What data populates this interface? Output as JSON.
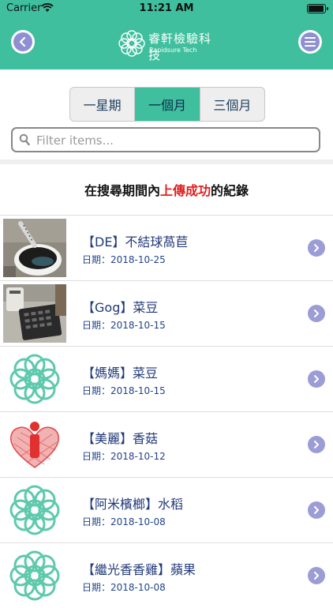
{
  "status_bar": {
    "carrier": "Carrier",
    "time": "11:21 AM"
  },
  "header": {
    "brand_cn": "睿軒檢驗科技",
    "brand_en": "Rapidsure Tech"
  },
  "tabs": [
    {
      "label": "一星期",
      "active": false
    },
    {
      "label": "一個月",
      "active": true
    },
    {
      "label": "三個月",
      "active": false
    }
  ],
  "search": {
    "placeholder": "Filter items...",
    "value": ""
  },
  "headline": {
    "before": "在搜尋期間內",
    "highlight": "上傳成功",
    "after": "的紀錄"
  },
  "records": [
    {
      "title": "【DE】不結球萵苣",
      "date": "日期：2018-10-25",
      "thumb": "coffee-photo"
    },
    {
      "title": "【Gog】菜豆",
      "date": "日期：2018-10-15",
      "thumb": "calculator-photo"
    },
    {
      "title": "【媽媽】菜豆",
      "date": "日期：2018-10-15",
      "thumb": "logo-pattern"
    },
    {
      "title": "【美麗】香菇",
      "date": "日期：2018-10-12",
      "thumb": "heart-info"
    },
    {
      "title": "【阿米檳榔】水稻",
      "date": "日期：2018-10-08",
      "thumb": "logo-pattern"
    },
    {
      "title": "【繼光香香雞】蘋果",
      "date": "日期：2018-10-08",
      "thumb": "logo-pattern"
    }
  ],
  "colors": {
    "accent": "#3fbf9e",
    "highlight": "#e02020",
    "chevron": "#9c9cd6"
  }
}
